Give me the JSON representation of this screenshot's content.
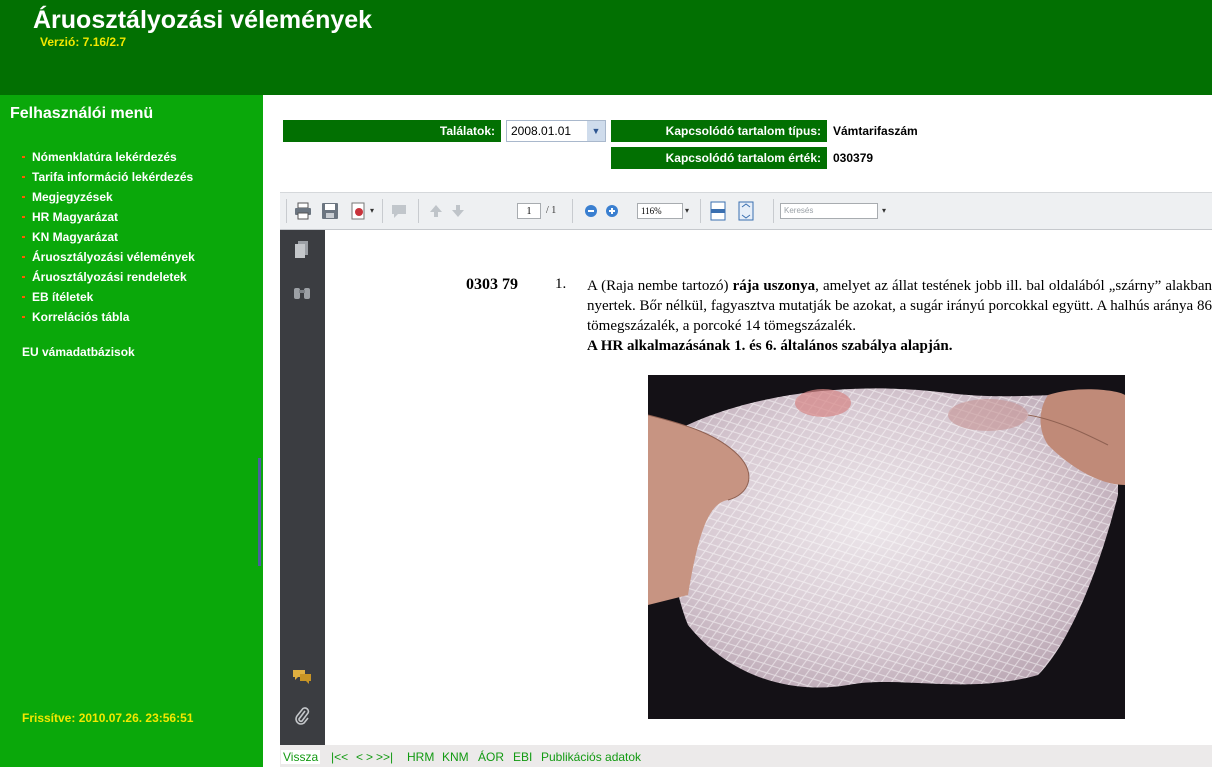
{
  "header": {
    "title": "Áruosztályozási vélemények",
    "version": "Verzió:  7.16/2.7"
  },
  "sidebar": {
    "menu_title": "Felhasználói menü",
    "items": [
      {
        "label": "Nómenklatúra lekérdezés"
      },
      {
        "label": "Tarifa információ lekérdezés"
      },
      {
        "label": "Megjegyzések"
      },
      {
        "label": "HR Magyarázat"
      },
      {
        "label": "KN Magyarázat"
      },
      {
        "label": "Áruosztályozási vélemények"
      },
      {
        "label": "Áruosztályozási rendeletek"
      },
      {
        "label": "EB ítéletek"
      },
      {
        "label": "Korrelációs tábla"
      }
    ],
    "eu_link": "EU vámadatbázisok",
    "updated": "Frissítve:  2010.07.26. 23:56:51"
  },
  "filters": {
    "hits_label": "Találatok:",
    "hits_value": "2008.01.01",
    "type_label": "Kapcsolódó tartalom típus:",
    "type_value": "Vámtarifaszám",
    "value_label": "Kapcsolódó tartalom érték:",
    "value_value": "030379"
  },
  "toolbar": {
    "page_current": "1",
    "page_total": "/ 1",
    "zoom": "116%",
    "search_placeholder": "Keresés"
  },
  "document": {
    "code": "0303 79",
    "item_number": "1.",
    "text_a": "A (Raja nembe tartozó) ",
    "text_bold": "rája uszonya",
    "text_b": ", amelyet az állat testének jobb ill. bal oldalából „szárny” alakban nyertek. Bőr nélkül, fagyasztva mutatják be azokat, a sugár irányú porcokkal együtt. A halhús aránya 86 tömegszázalék, a porcoké 14 tömegszázalék.",
    "rule": "A HR alkalmazásának 1. és 6. általános szabálya alapján."
  },
  "bottom_nav": {
    "back": "Vissza",
    "first": "|<<",
    "prev": "<",
    "next": ">",
    "last": ">>|",
    "hrm": "HRM",
    "knm": "KNM",
    "aor": "ÁOR",
    "ebi": "EBI",
    "publication": "Publikációs adatok"
  },
  "icons": {
    "print": "printer-icon",
    "save": "disk-icon",
    "attach": "paperclip-icon"
  },
  "colors": {
    "header_green": "#027002",
    "sidebar_green": "#0aa80a",
    "label_green": "#027002",
    "accent_yellow": "#f2e800",
    "bullet_orange": "#ff5a00",
    "link_green": "#129a12"
  }
}
